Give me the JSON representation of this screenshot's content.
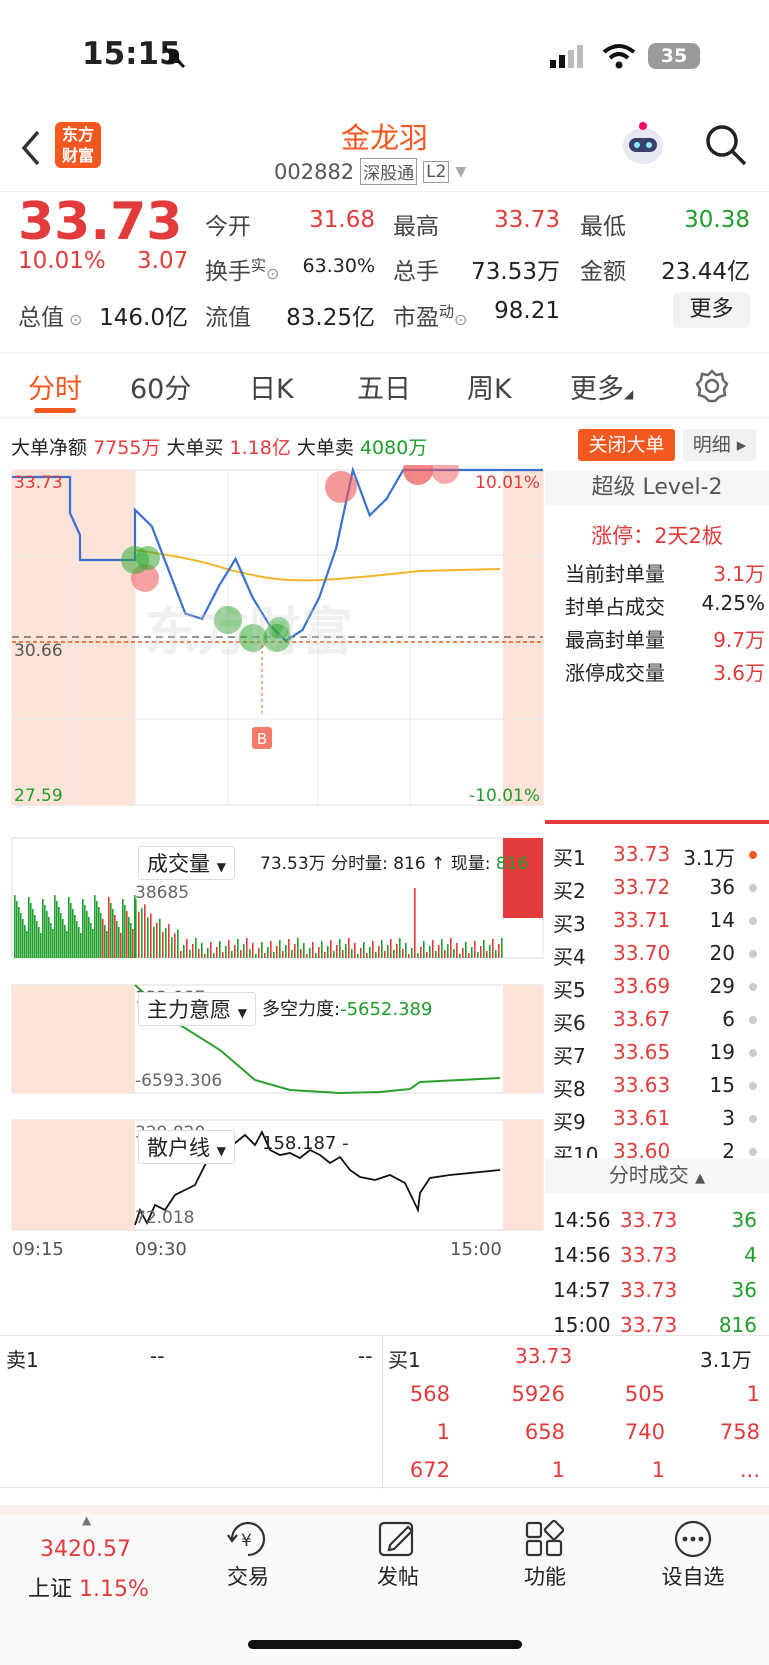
{
  "status_bar": {
    "time": "15:15",
    "battery": "35"
  },
  "header": {
    "logo_line1": "东方",
    "logo_line2": "财富",
    "stock_name": "金龙羽",
    "stock_code": "002882",
    "tag_market": "深股通",
    "tag_level": "L2"
  },
  "quote": {
    "price": "33.73",
    "change_pct": "10.01%",
    "change": "3.07",
    "open_label": "今开",
    "open": "31.68",
    "high_label": "最高",
    "high": "33.73",
    "low_label": "最低",
    "low": "30.38",
    "turnover_label": "换手",
    "turnover_sup": "实",
    "turnover": "63.30%",
    "volume_label": "总手",
    "volume": "73.53万",
    "amount_label": "金额",
    "amount": "23.44亿",
    "mcap_label": "总值",
    "mcap": "146.0亿",
    "float_label": "流值",
    "float": "83.25亿",
    "pe_label": "市盈",
    "pe_sup": "动",
    "pe": "98.21",
    "more_btn": "更多"
  },
  "tabs": [
    {
      "label": "分时"
    },
    {
      "label": "60分"
    },
    {
      "label": "日K"
    },
    {
      "label": "五日"
    },
    {
      "label": "周K"
    },
    {
      "label": "更多"
    }
  ],
  "big_order": {
    "net_label": "大单净额",
    "net": "7755万",
    "buy_label": "大单买",
    "buy": "1.18亿",
    "sell_label": "大单卖",
    "sell": "4080万",
    "close_btn": "关闭大单",
    "detail_btn": "明细"
  },
  "chart": {
    "price_top": "33.73",
    "price_mid": "30.66",
    "price_bot": "27.59",
    "pct_top": "10.01%",
    "pct_bot": "-10.01%",
    "b_marker": "B",
    "vol_label": "成交量",
    "vol_info": "73.53万 分时量: 816 ↑ 现量:",
    "vol_cur": "816",
    "vol_max": "38685",
    "main_label": "主力意愿",
    "main_info": "多空力度:",
    "main_val": "-5652.389",
    "main_top": "132.087",
    "main_bot": "-6593.306",
    "retail_label": "散户线",
    "retail_info": "158.187 -",
    "retail_top": "329.820",
    "retail_bot": "72.018",
    "time_start": "09:15",
    "time_open": "09:30",
    "time_end": "15:00",
    "watermark": "东方财富"
  },
  "chart_data": {
    "type": "line",
    "series": [
      {
        "values": [
          33.0,
          32.7,
          31.9,
          31.1,
          31.0,
          31.6,
          32.1,
          31.4,
          30.9,
          30.6,
          30.8,
          31.4,
          32.3,
          33.73,
          32.9,
          33.2,
          33.73,
          33.73
        ]
      }
    ],
    "ylim": [
      27.59,
      33.73
    ]
  },
  "level2": {
    "title": "超级 Level-2",
    "limit_up": "涨停：2天2板",
    "rows": [
      {
        "k": "当前封单量",
        "v": "3.1万"
      },
      {
        "k": "封单占成交",
        "v": "4.25%"
      },
      {
        "k": "最高封单量",
        "v": "9.7万"
      },
      {
        "k": "涨停成交量",
        "v": "3.6万"
      }
    ]
  },
  "bids": [
    {
      "l": "买1",
      "p": "33.73",
      "v": "3.1万"
    },
    {
      "l": "买2",
      "p": "33.72",
      "v": "36"
    },
    {
      "l": "买3",
      "p": "33.71",
      "v": "14"
    },
    {
      "l": "买4",
      "p": "33.70",
      "v": "20"
    },
    {
      "l": "买5",
      "p": "33.69",
      "v": "29"
    },
    {
      "l": "买6",
      "p": "33.67",
      "v": "6"
    },
    {
      "l": "买7",
      "p": "33.65",
      "v": "19"
    },
    {
      "l": "买8",
      "p": "33.63",
      "v": "15"
    },
    {
      "l": "买9",
      "p": "33.61",
      "v": "3"
    },
    {
      "l": "买10",
      "p": "33.60",
      "v": "2"
    }
  ],
  "ticks_title": "分时成交",
  "ticks": [
    {
      "t": "14:56",
      "p": "33.73",
      "v": "36"
    },
    {
      "t": "14:56",
      "p": "33.73",
      "v": "4"
    },
    {
      "t": "14:57",
      "p": "33.73",
      "v": "36"
    },
    {
      "t": "15:00",
      "p": "33.73",
      "v": "816"
    }
  ],
  "book": {
    "sell_label": "卖1",
    "sell_price": "--",
    "sell_vol": "--",
    "buy_label": "买1",
    "buy_price": "33.73",
    "buy_vol": "3.1万",
    "queue": [
      [
        "568",
        "5926",
        "505",
        "1"
      ],
      [
        "1",
        "658",
        "740",
        "758"
      ],
      [
        "672",
        "1",
        "1",
        "..."
      ]
    ]
  },
  "bottom": {
    "index_val": "3420.57",
    "index_name": "上证",
    "index_pct": "1.15%",
    "items": [
      {
        "label": "交易"
      },
      {
        "label": "发帖"
      },
      {
        "label": "功能"
      },
      {
        "label": "设自选"
      }
    ]
  },
  "colors": {
    "up": "#e33b3b",
    "down": "#1f9e2c",
    "accent": "#f2581f"
  }
}
